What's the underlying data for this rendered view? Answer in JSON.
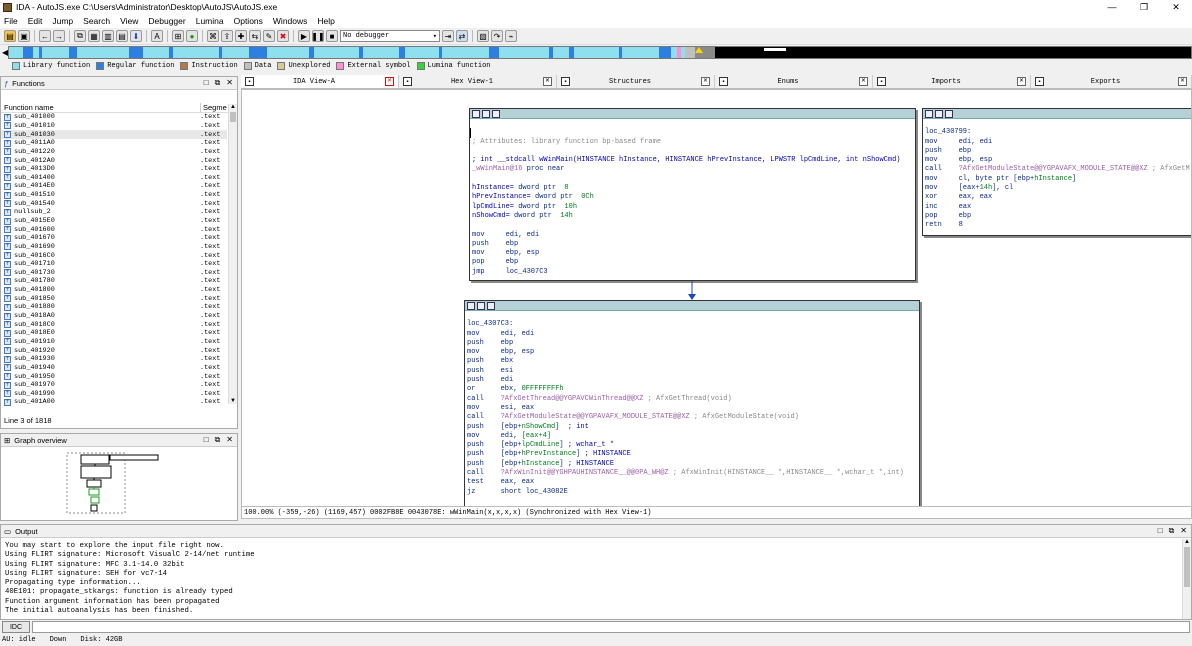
{
  "app": {
    "title": "IDA - AutoJS.exe C:\\Users\\Administrator\\Desktop\\AutoJS\\AutoJS.exe",
    "win_min": "—",
    "win_max": "❐",
    "win_close": "✕"
  },
  "menu": [
    "File",
    "Edit",
    "Jump",
    "Search",
    "View",
    "Debugger",
    "Lumina",
    "Options",
    "Windows",
    "Help"
  ],
  "toolbar": {
    "debugger_select": "No debugger"
  },
  "legend": [
    {
      "label": "Library function",
      "color": "#8fe0ee"
    },
    {
      "label": "Regular function",
      "color": "#2d7fe0"
    },
    {
      "label": "Instruction",
      "color": "#b07a4a"
    },
    {
      "label": "Data",
      "color": "#c0c0c0"
    },
    {
      "label": "Unexplored",
      "color": "#d8c89a"
    },
    {
      "label": "External symbol",
      "color": "#ff8fd0"
    },
    {
      "label": "Lumina function",
      "color": "#3ad13a"
    }
  ],
  "functions": {
    "title": "Functions",
    "col_name": "Function name",
    "col_segment": "Segme",
    "rows": [
      {
        "name": "sub_401000",
        "seg": ".text"
      },
      {
        "name": "sub_401010",
        "seg": ".text"
      },
      {
        "name": "sub_401030",
        "seg": ".text"
      },
      {
        "name": "sub_4011A0",
        "seg": ".text"
      },
      {
        "name": "sub_401220",
        "seg": ".text"
      },
      {
        "name": "sub_4012A0",
        "seg": ".text"
      },
      {
        "name": "sub_4013D0",
        "seg": ".text"
      },
      {
        "name": "sub_401400",
        "seg": ".text"
      },
      {
        "name": "sub_4014E0",
        "seg": ".text"
      },
      {
        "name": "sub_401510",
        "seg": ".text"
      },
      {
        "name": "sub_401540",
        "seg": ".text"
      },
      {
        "name": "nullsub_2",
        "seg": ".text"
      },
      {
        "name": "sub_4015E0",
        "seg": ".text"
      },
      {
        "name": "sub_401600",
        "seg": ".text"
      },
      {
        "name": "sub_401670",
        "seg": ".text"
      },
      {
        "name": "sub_401690",
        "seg": ".text"
      },
      {
        "name": "sub_4016C0",
        "seg": ".text"
      },
      {
        "name": "sub_401710",
        "seg": ".text"
      },
      {
        "name": "sub_401730",
        "seg": ".text"
      },
      {
        "name": "sub_401780",
        "seg": ".text"
      },
      {
        "name": "sub_401800",
        "seg": ".text"
      },
      {
        "name": "sub_401850",
        "seg": ".text"
      },
      {
        "name": "sub_401880",
        "seg": ".text"
      },
      {
        "name": "sub_4018A0",
        "seg": ".text"
      },
      {
        "name": "sub_4018C0",
        "seg": ".text"
      },
      {
        "name": "sub_4018E0",
        "seg": ".text"
      },
      {
        "name": "sub_401910",
        "seg": ".text"
      },
      {
        "name": "sub_401920",
        "seg": ".text"
      },
      {
        "name": "sub_401930",
        "seg": ".text"
      },
      {
        "name": "sub_401940",
        "seg": ".text"
      },
      {
        "name": "sub_401950",
        "seg": ".text"
      },
      {
        "name": "sub_401970",
        "seg": ".text"
      },
      {
        "name": "sub_401990",
        "seg": ".text"
      },
      {
        "name": "sub_401A00",
        "seg": ".text"
      }
    ],
    "status": "Line 3 of 1818"
  },
  "graph_overview": {
    "title": "Graph overview"
  },
  "tabs": [
    {
      "label": "IDA View-A",
      "active": true
    },
    {
      "label": "Hex View-1",
      "active": false
    },
    {
      "label": "Structures",
      "active": false
    },
    {
      "label": "Enums",
      "active": false
    },
    {
      "label": "Imports",
      "active": false
    },
    {
      "label": "Exports",
      "active": false
    }
  ],
  "node1": [
    {
      "t": "",
      "c": ""
    },
    {
      "t": "",
      "c": ""
    },
    {
      "t": "; Attributes: library function bp-based frame",
      "c": "gray"
    },
    {
      "t": "",
      "c": ""
    },
    {
      "t": "; int __stdcall wWinMain(HINSTANCE hInstance, HINSTANCE hPrevInstance, LPWSTR lpCmdLine, int nShowCmd)",
      "c": "blue"
    },
    {
      "t": "_wWinMain@16 proc near",
      "c": "mix1"
    },
    {
      "t": "",
      "c": ""
    },
    {
      "t": "hInstance= dword ptr  8",
      "c": "mixv"
    },
    {
      "t": "hPrevInstance= dword ptr  0Ch",
      "c": "mixv"
    },
    {
      "t": "lpCmdLine= dword ptr  10h",
      "c": "mixv"
    },
    {
      "t": "nShowCmd= dword ptr  14h",
      "c": "mixv"
    },
    {
      "t": "",
      "c": ""
    },
    {
      "t": "mov     edi, edi",
      "c": "navy"
    },
    {
      "t": "push    ebp",
      "c": "navy"
    },
    {
      "t": "mov     ebp, esp",
      "c": "navy"
    },
    {
      "t": "pop     ebp",
      "c": "navy"
    },
    {
      "t": "jmp     loc_4307C3",
      "c": "navy"
    }
  ],
  "node2": [
    {
      "t": "",
      "c": ""
    },
    {
      "t": "loc_430799:",
      "c": "navy"
    },
    {
      "t": "mov     edi, edi",
      "c": "navy"
    },
    {
      "t": "push    ebp",
      "c": "navy"
    },
    {
      "t": "mov     ebp, esp",
      "c": "navy"
    },
    {
      "t": "call    ?AfxGetModuleState@@YGPAVAFX_MODULE_STATE@@XZ ; AfxGetM",
      "c": "callp"
    },
    {
      "t": "mov     cl, byte ptr [ebp+hInstance]",
      "c": "navy"
    },
    {
      "t": "mov     [eax+14h], cl",
      "c": "navy"
    },
    {
      "t": "xor     eax, eax",
      "c": "navy"
    },
    {
      "t": "inc     eax",
      "c": "navy"
    },
    {
      "t": "pop     ebp",
      "c": "navy"
    },
    {
      "t": "retn    8",
      "c": "navy"
    }
  ],
  "node3": [
    {
      "t": "",
      "c": ""
    },
    {
      "t": "loc_4307C3:",
      "c": "navy"
    },
    {
      "t": "mov     edi, edi",
      "c": "navy"
    },
    {
      "t": "push    ebp",
      "c": "navy"
    },
    {
      "t": "mov     ebp, esp",
      "c": "navy"
    },
    {
      "t": "push    ebx",
      "c": "navy"
    },
    {
      "t": "push    esi",
      "c": "navy"
    },
    {
      "t": "push    edi",
      "c": "navy"
    },
    {
      "t": "or      ebx, 0FFFFFFFFh",
      "c": "navy"
    },
    {
      "t": "call    ?AfxGetThread@@YGPAVCWinThread@@XZ ; AfxGetThread(void)",
      "c": "callp"
    },
    {
      "t": "mov     esi, eax",
      "c": "navy"
    },
    {
      "t": "call    ?AfxGetModuleState@@YGPAVAFX_MODULE_STATE@@XZ ; AfxGetModuleState(void)",
      "c": "callp"
    },
    {
      "t": "push    [ebp+nShowCmd]  ; int",
      "c": "navy"
    },
    {
      "t": "mov     edi, [eax+4]",
      "c": "navy"
    },
    {
      "t": "push    [ebp+lpCmdLine] ; wchar_t *",
      "c": "navy"
    },
    {
      "t": "push    [ebp+hPrevInstance] ; HINSTANCE",
      "c": "navy"
    },
    {
      "t": "push    [ebp+hInstance] ; HINSTANCE",
      "c": "navy"
    },
    {
      "t": "call    ?AfxWinInit@@YGHPAUHINSTANCE__@@0PA_WH@Z ; AfxWinInit(HINSTANCE__ *,HINSTANCE__ *,wchar_t *,int)",
      "c": "callp"
    },
    {
      "t": "test    eax, eax",
      "c": "navy"
    },
    {
      "t": "jz      short loc_43082E",
      "c": "navy"
    }
  ],
  "graph_status": "100.00% (-359,-26) (1169,457) 0002FB8E 0043078E: wWinMain(x,x,x,x) (Synchronized with Hex View-1)",
  "output": {
    "title": "Output",
    "text": "You may start to explore the input file right now.\nUsing FLIRT signature: Microsoft VisualC 2-14/net runtime\nUsing FLIRT signature: MFC 3.1-14.0 32bit\nUsing FLIRT signature: SEH for vc7-14\nPropagating type information...\n40E101: propagate_stkargs: function is already typed\nFunction argument information has been propagated\nThe initial autoanalysis has been finished."
  },
  "idc": {
    "label": "IDC"
  },
  "status": {
    "au": "AU:  idle",
    "dir": "Down",
    "disk": "Disk: 42GB"
  }
}
